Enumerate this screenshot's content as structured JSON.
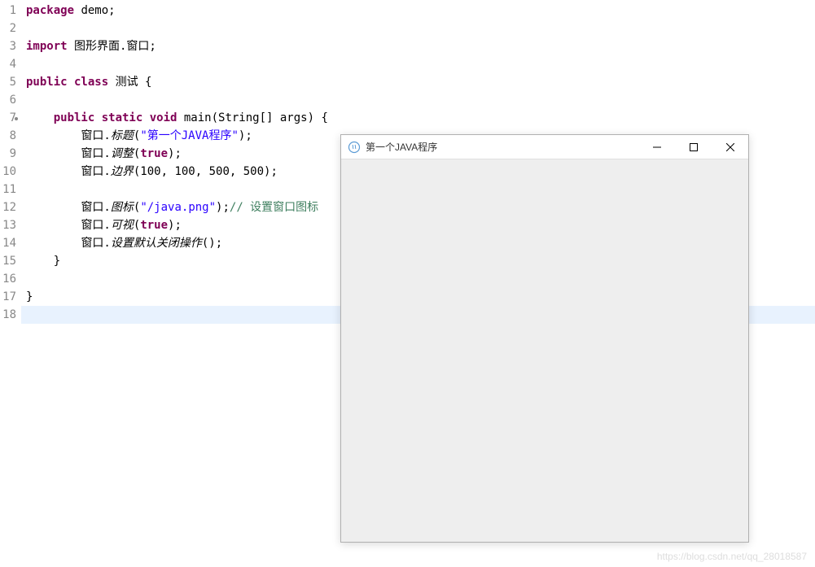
{
  "lines": [
    {
      "n": "1"
    },
    {
      "n": "2"
    },
    {
      "n": "3"
    },
    {
      "n": "4"
    },
    {
      "n": "5"
    },
    {
      "n": "6"
    },
    {
      "n": "7"
    },
    {
      "n": "8"
    },
    {
      "n": "9"
    },
    {
      "n": "10"
    },
    {
      "n": "11"
    },
    {
      "n": "12"
    },
    {
      "n": "13"
    },
    {
      "n": "14"
    },
    {
      "n": "15"
    },
    {
      "n": "16"
    },
    {
      "n": "17"
    },
    {
      "n": "18"
    }
  ],
  "code": {
    "l1": {
      "kw": "package",
      "rest": " demo;"
    },
    "l3": {
      "kw": "import",
      "rest": " 图形界面.窗口;"
    },
    "l5a": {
      "kw": "public class",
      "rest": " 测试 {"
    },
    "l7a": {
      "indent": "    ",
      "kw": "public static void",
      "rest": " main(String[] args) {"
    },
    "l8": {
      "indent": "        ",
      "pre": "窗口.",
      "it": "标题",
      "open": "(",
      "str": "\"第一个JAVA程序\"",
      "close": ");"
    },
    "l9": {
      "indent": "        ",
      "pre": "窗口.",
      "it": "调整",
      "open": "(",
      "kw": "true",
      "close": ");"
    },
    "l10": {
      "indent": "        ",
      "pre": "窗口.",
      "it": "边界",
      "rest": "(100, 100, 500, 500);"
    },
    "l12": {
      "indent": "        ",
      "pre": "窗口.",
      "it": "图标",
      "open": "(",
      "str": "\"/java.png\"",
      "close": ");",
      "com": "// 设置窗口图标"
    },
    "l13": {
      "indent": "        ",
      "pre": "窗口.",
      "it": "可视",
      "open": "(",
      "kw": "true",
      "close": ");"
    },
    "l14": {
      "indent": "        ",
      "pre": "窗口.",
      "it": "设置默认关闭操作",
      "rest": "();"
    },
    "l15": {
      "indent": "    ",
      "rest": "}"
    },
    "l17": {
      "rest": "}"
    }
  },
  "window": {
    "title": "第一个JAVA程序"
  },
  "watermark": "https://blog.csdn.net/qq_28018587"
}
